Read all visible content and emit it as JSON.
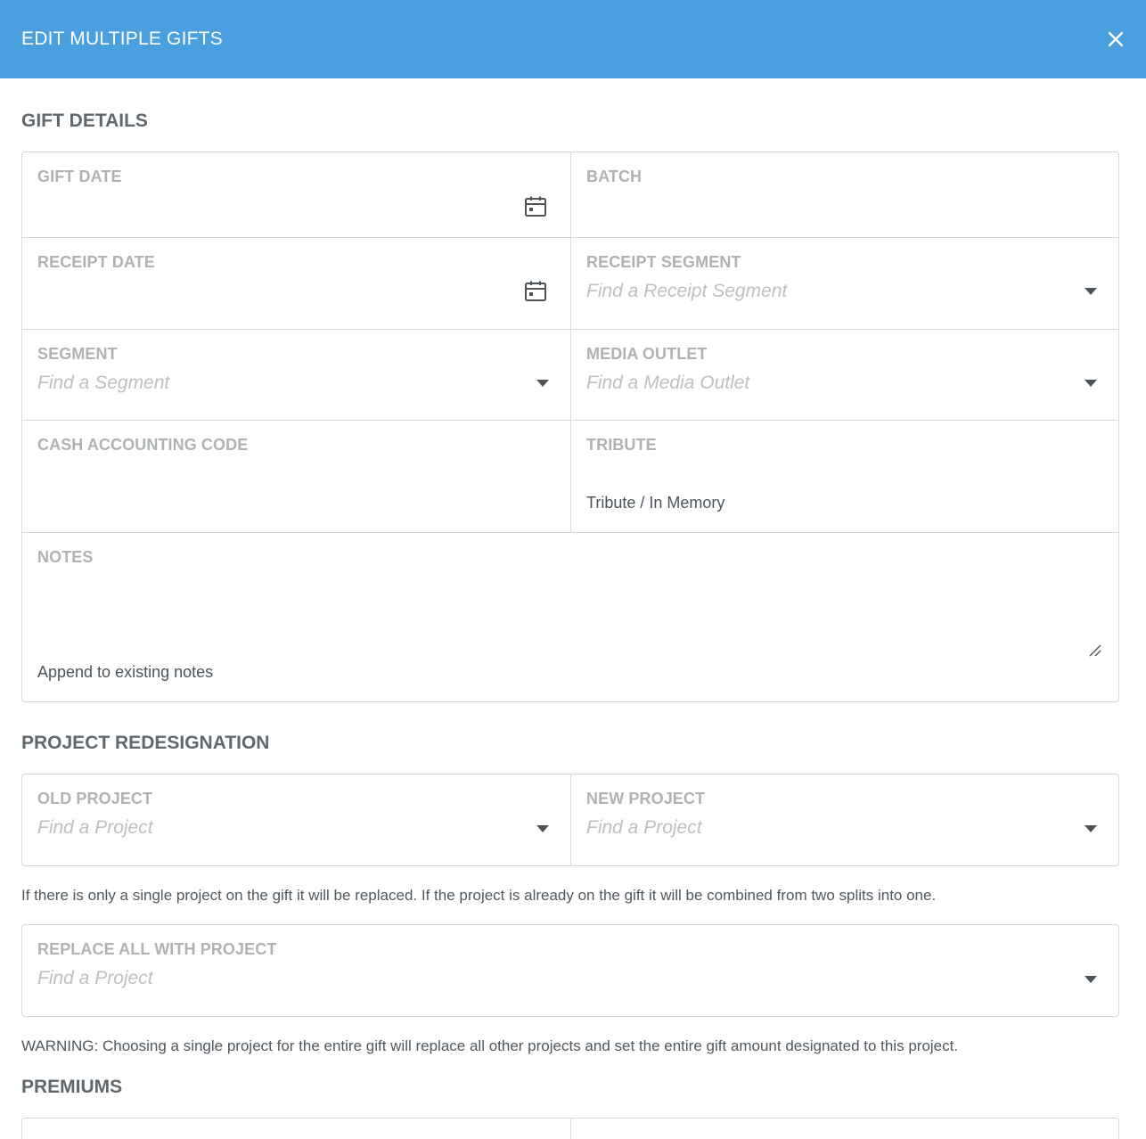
{
  "header": {
    "title": "EDIT MULTIPLE GIFTS"
  },
  "gift_details": {
    "title": "GIFT DETAILS",
    "gift_date": {
      "label": "GIFT DATE"
    },
    "batch": {
      "label": "BATCH"
    },
    "receipt_date": {
      "label": "RECEIPT DATE"
    },
    "receipt_segment": {
      "label": "RECEIPT SEGMENT",
      "placeholder": "Find a Receipt Segment"
    },
    "segment": {
      "label": "SEGMENT",
      "placeholder": "Find a Segment"
    },
    "media_outlet": {
      "label": "MEDIA OUTLET",
      "placeholder": "Find a Media Outlet"
    },
    "cash_accounting_code": {
      "label": "CASH ACCOUNTING CODE"
    },
    "tribute": {
      "label": "TRIBUTE",
      "option_label": "Tribute / In Memory"
    },
    "notes": {
      "label": "NOTES",
      "append_label": "Append to existing notes"
    }
  },
  "project_redesignation": {
    "title": "PROJECT REDESIGNATION",
    "old_project": {
      "label": "OLD PROJECT",
      "placeholder": "Find a Project"
    },
    "new_project": {
      "label": "NEW PROJECT",
      "placeholder": "Find a Project"
    },
    "info_text": "If there is only a single project on the gift it will be replaced. If the project is already on the gift it will be combined from two splits into one.",
    "replace_all": {
      "label": "REPLACE ALL WITH PROJECT",
      "placeholder": "Find a Project"
    },
    "warning_text": "WARNING: Choosing a single project for the entire gift will replace all other projects and set the entire gift amount designated to this project."
  },
  "premiums": {
    "title": "PREMIUMS"
  },
  "colors": {
    "header_bg": "#4aa0de",
    "border": "#d6d9dc",
    "label": "#aeb2b5",
    "placeholder": "#bcc0c3"
  },
  "icons": [
    "close-icon",
    "calendar-icon",
    "chevron-down-icon",
    "resize-handle-icon"
  ]
}
